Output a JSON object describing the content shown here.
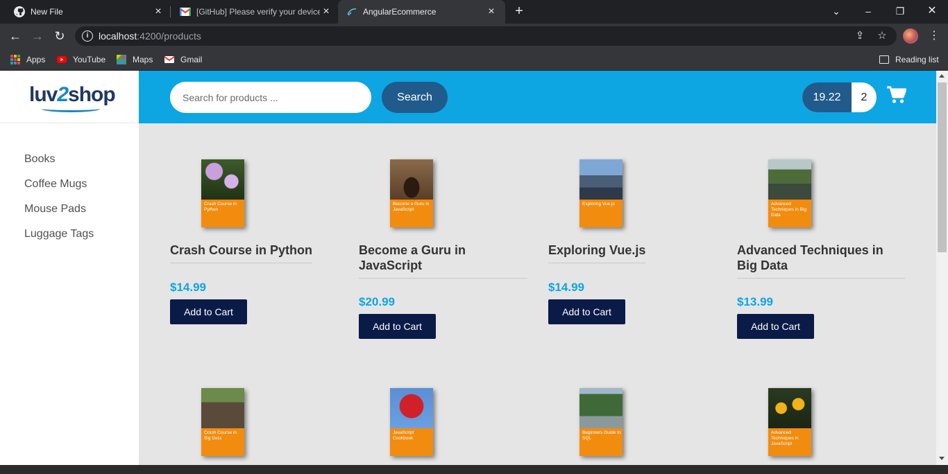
{
  "browser": {
    "tabs": [
      {
        "title": "New File",
        "icon": "github-icon"
      },
      {
        "title": "[GitHub] Please verify your device",
        "icon": "gmail-icon"
      },
      {
        "title": "AngularEcommerce",
        "icon": "angular-icon"
      }
    ],
    "url_host": "localhost",
    "url_path": ":4200/products",
    "bookmarks": [
      "Apps",
      "YouTube",
      "Maps",
      "Gmail"
    ],
    "reading_list": "Reading list"
  },
  "header": {
    "search_placeholder": "Search for products ...",
    "search_button": "Search",
    "cart_total": "19.22",
    "cart_quantity": "2"
  },
  "sidebar": {
    "logo_left": "luv",
    "logo_two": "2",
    "logo_right": "shop",
    "categories": [
      "Books",
      "Coffee Mugs",
      "Mouse Pads",
      "Luggage Tags"
    ]
  },
  "products": [
    {
      "name": "Crash Course in Python",
      "price": "$14.99",
      "cover_text": "Crash Course in Python"
    },
    {
      "name": "Become a Guru in JavaScript",
      "price": "$20.99",
      "cover_text": "Become a Guru in JavaScript"
    },
    {
      "name": "Exploring Vue.js",
      "price": "$14.99",
      "cover_text": "Exploring Vue.js"
    },
    {
      "name": "Advanced Techniques in Big Data",
      "price": "$13.99",
      "cover_text": "Advanced Techniques in Big Data"
    },
    {
      "cover_text": "Crash Course in Big Data"
    },
    {
      "cover_text": "JavaScript Cookbook"
    },
    {
      "cover_text": "Beginners Guide to SQL"
    },
    {
      "cover_text": "Advanced Techniques in JavaScript"
    }
  ],
  "add_to_cart_label": "Add to Cart",
  "colors": {
    "header": "#0ea5e3",
    "price": "#0ea5e3",
    "button": "#0b1b47",
    "cover_band": "#f28c0f"
  }
}
